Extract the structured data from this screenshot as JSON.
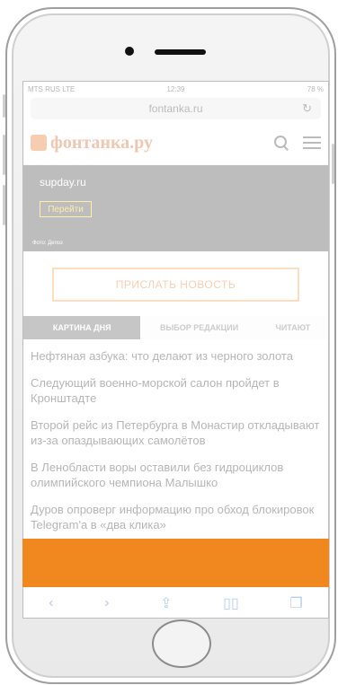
{
  "status": {
    "carrier": "MTS RUS  LTE",
    "time": "12:39",
    "battery": "78 %"
  },
  "browser": {
    "url": "fontanka.ru"
  },
  "site": {
    "logo_text": "фонтанка.ру"
  },
  "banner": {
    "domain": "supday.ru",
    "button": "Перейти",
    "caption": "Фото: Депоз"
  },
  "send_news": "ПРИСЛАТЬ НОВОСТЬ",
  "tabs": [
    {
      "label": "КАРТИНА ДНЯ"
    },
    {
      "label": "ВЫБОР РЕДАКЦИИ"
    },
    {
      "label": "ЧИТАЮТ"
    }
  ],
  "news": [
    "Нефтяная азбука: что делают из черного золота",
    "Следующий военно-морской салон пройдет в Кронштадте",
    "Второй рейс из Петербурга в Монастир откладывают из-за опаздывающих самолётов",
    "В Ленобласти воры оставили без гидроциклов олимпийского чемпиона Малышко",
    "Дуров опроверг информацию про обход блокировок Telegram'а в «два клика»"
  ],
  "colors": {
    "accent": "#f1871f"
  }
}
